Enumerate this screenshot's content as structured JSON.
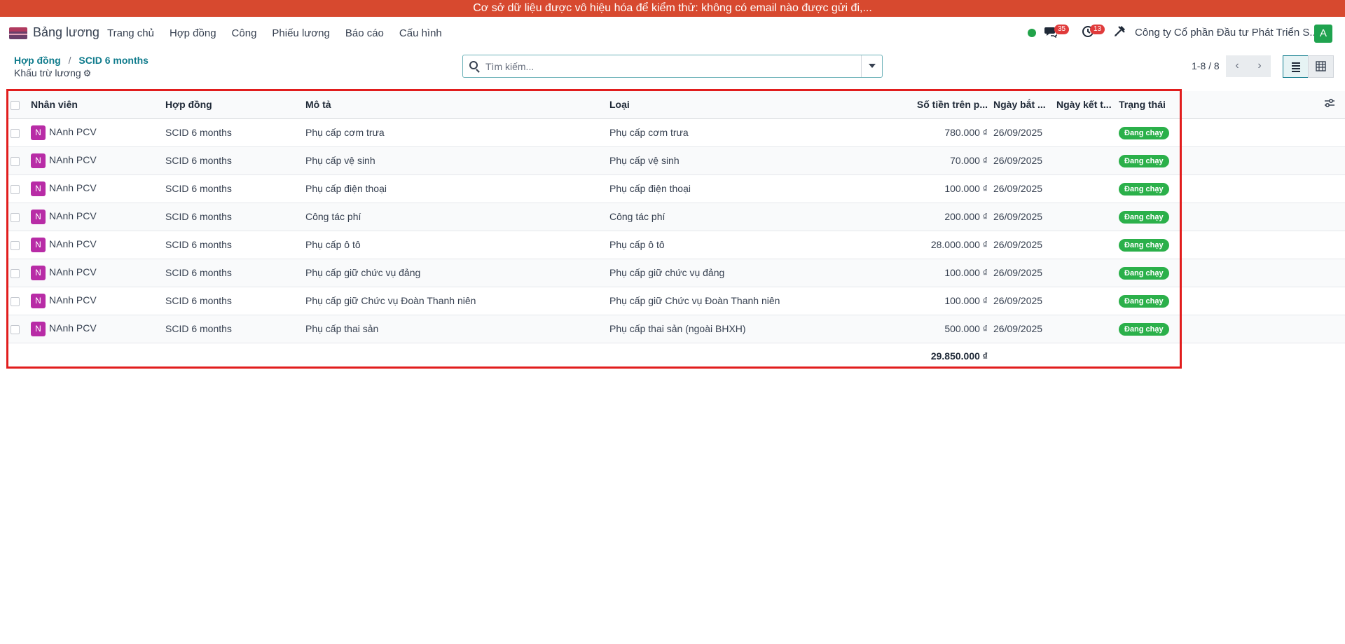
{
  "banner": {
    "text": "Cơ sở dữ liệu được vô hiệu hóa để kiểm thử: không có email nào được gửi đi,..."
  },
  "navbar": {
    "app_name": "Bảng lương",
    "menu": [
      "Trang chủ",
      "Hợp đồng",
      "Công",
      "Phiếu lương",
      "Báo cáo",
      "Cấu hình"
    ],
    "messages_count": "35",
    "activities_count": "13",
    "company": "Công ty Cổ phần Đầu tư Phát Triển S...",
    "user_initial": "A"
  },
  "breadcrumb": {
    "parent": "Hợp đồng",
    "current": "SCID 6 months"
  },
  "subtitle": "Khấu trừ lương",
  "search": {
    "placeholder": "Tìm kiếm..."
  },
  "pager": {
    "text": "1-8 / 8"
  },
  "table": {
    "headers": [
      "Nhân viên",
      "Hợp đồng",
      "Mô tả",
      "Loại",
      "Số tiền trên p...",
      "Ngày bắt ...",
      "Ngày kết t...",
      "Trạng thái"
    ],
    "rows": [
      {
        "initial": "N",
        "employee": "NAnh PCV",
        "contract": "SCID 6 months",
        "description": "Phụ cấp cơm trưa",
        "type": "Phụ cấp cơm trưa",
        "amount": "780.000 ₫",
        "start": "26/09/2025",
        "end": "",
        "state": "Đang chạy"
      },
      {
        "initial": "N",
        "employee": "NAnh PCV",
        "contract": "SCID 6 months",
        "description": "Phụ cấp vệ sinh",
        "type": "Phụ cấp vệ sinh",
        "amount": "70.000 ₫",
        "start": "26/09/2025",
        "end": "",
        "state": "Đang chạy"
      },
      {
        "initial": "N",
        "employee": "NAnh PCV",
        "contract": "SCID 6 months",
        "description": "Phụ cấp điện thoại",
        "type": "Phụ cấp điện thoại",
        "amount": "100.000 ₫",
        "start": "26/09/2025",
        "end": "",
        "state": "Đang chạy"
      },
      {
        "initial": "N",
        "employee": "NAnh PCV",
        "contract": "SCID 6 months",
        "description": "Công tác phí",
        "type": "Công tác phí",
        "amount": "200.000 ₫",
        "start": "26/09/2025",
        "end": "",
        "state": "Đang chạy"
      },
      {
        "initial": "N",
        "employee": "NAnh PCV",
        "contract": "SCID 6 months",
        "description": "Phụ cấp ô tô",
        "type": "Phụ cấp ô tô",
        "amount": "28.000.000 ₫",
        "start": "26/09/2025",
        "end": "",
        "state": "Đang chạy"
      },
      {
        "initial": "N",
        "employee": "NAnh PCV",
        "contract": "SCID 6 months",
        "description": "Phụ cấp giữ chức vụ đảng",
        "type": "Phụ cấp giữ chức vụ đảng",
        "amount": "100.000 ₫",
        "start": "26/09/2025",
        "end": "",
        "state": "Đang chạy"
      },
      {
        "initial": "N",
        "employee": "NAnh PCV",
        "contract": "SCID 6 months",
        "description": "Phụ cấp giữ Chức vụ Đoàn Thanh niên",
        "type": "Phụ cấp giữ Chức vụ Đoàn Thanh niên",
        "amount": "100.000 ₫",
        "start": "26/09/2025",
        "end": "",
        "state": "Đang chạy"
      },
      {
        "initial": "N",
        "employee": "NAnh PCV",
        "contract": "SCID 6 months",
        "description": "Phụ cấp thai sản",
        "type": "Phụ cấp thai sản (ngoài BHXH)",
        "amount": "500.000 ₫",
        "start": "26/09/2025",
        "end": "",
        "state": "Đang chạy"
      }
    ],
    "total": "29.850.000 ₫"
  },
  "colors": {
    "banner": "#d7492f",
    "accent": "#0f7b8c",
    "state_running": "#2bb04a",
    "employee_avatar": "#b82ca6",
    "highlight": "#e11d1d"
  },
  "icons": {
    "messages": "chat-icon",
    "activities": "clock-icon",
    "tools": "tools-icon",
    "settings": "gear-icon",
    "search": "search-icon",
    "list_view": "list-icon",
    "pivot_view": "grid-icon",
    "column_settings": "sliders-icon"
  }
}
